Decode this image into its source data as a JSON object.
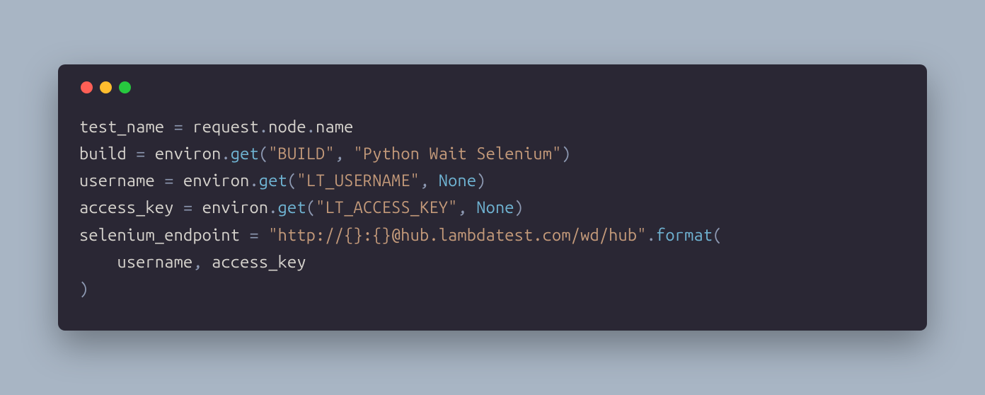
{
  "window": {
    "traffic": {
      "red": "#ff5f56",
      "yellow": "#ffbd2e",
      "green": "#27c93f"
    }
  },
  "code": {
    "line1": {
      "var": "test_name",
      "eq": " = ",
      "obj": "request",
      "dot1": ".",
      "prop1": "node",
      "dot2": ".",
      "prop2": "name"
    },
    "line2": {
      "var": "build",
      "eq": " = ",
      "obj": "environ",
      "dot": ".",
      "method": "get",
      "lp": "(",
      "arg1": "\"BUILD\"",
      "comma": ", ",
      "arg2": "\"Python Wait Selenium\"",
      "rp": ")"
    },
    "line3": {
      "var": "username",
      "eq": " = ",
      "obj": "environ",
      "dot": ".",
      "method": "get",
      "lp": "(",
      "arg1": "\"LT_USERNAME\"",
      "comma": ", ",
      "arg2": "None",
      "rp": ")"
    },
    "line4": {
      "var": "access_key",
      "eq": " = ",
      "obj": "environ",
      "dot": ".",
      "method": "get",
      "lp": "(",
      "arg1": "\"LT_ACCESS_KEY\"",
      "comma": ", ",
      "arg2": "None",
      "rp": ")"
    },
    "line5": {
      "var": "selenium_endpoint",
      "eq": " = ",
      "str": "\"http://{}:{}@hub.lambdatest.com/wd/hub\"",
      "dot": ".",
      "method": "format",
      "lp": "("
    },
    "line6": {
      "indent": "    ",
      "arg1": "username",
      "comma": ", ",
      "arg2": "access_key"
    },
    "line7": {
      "rp": ")"
    }
  }
}
